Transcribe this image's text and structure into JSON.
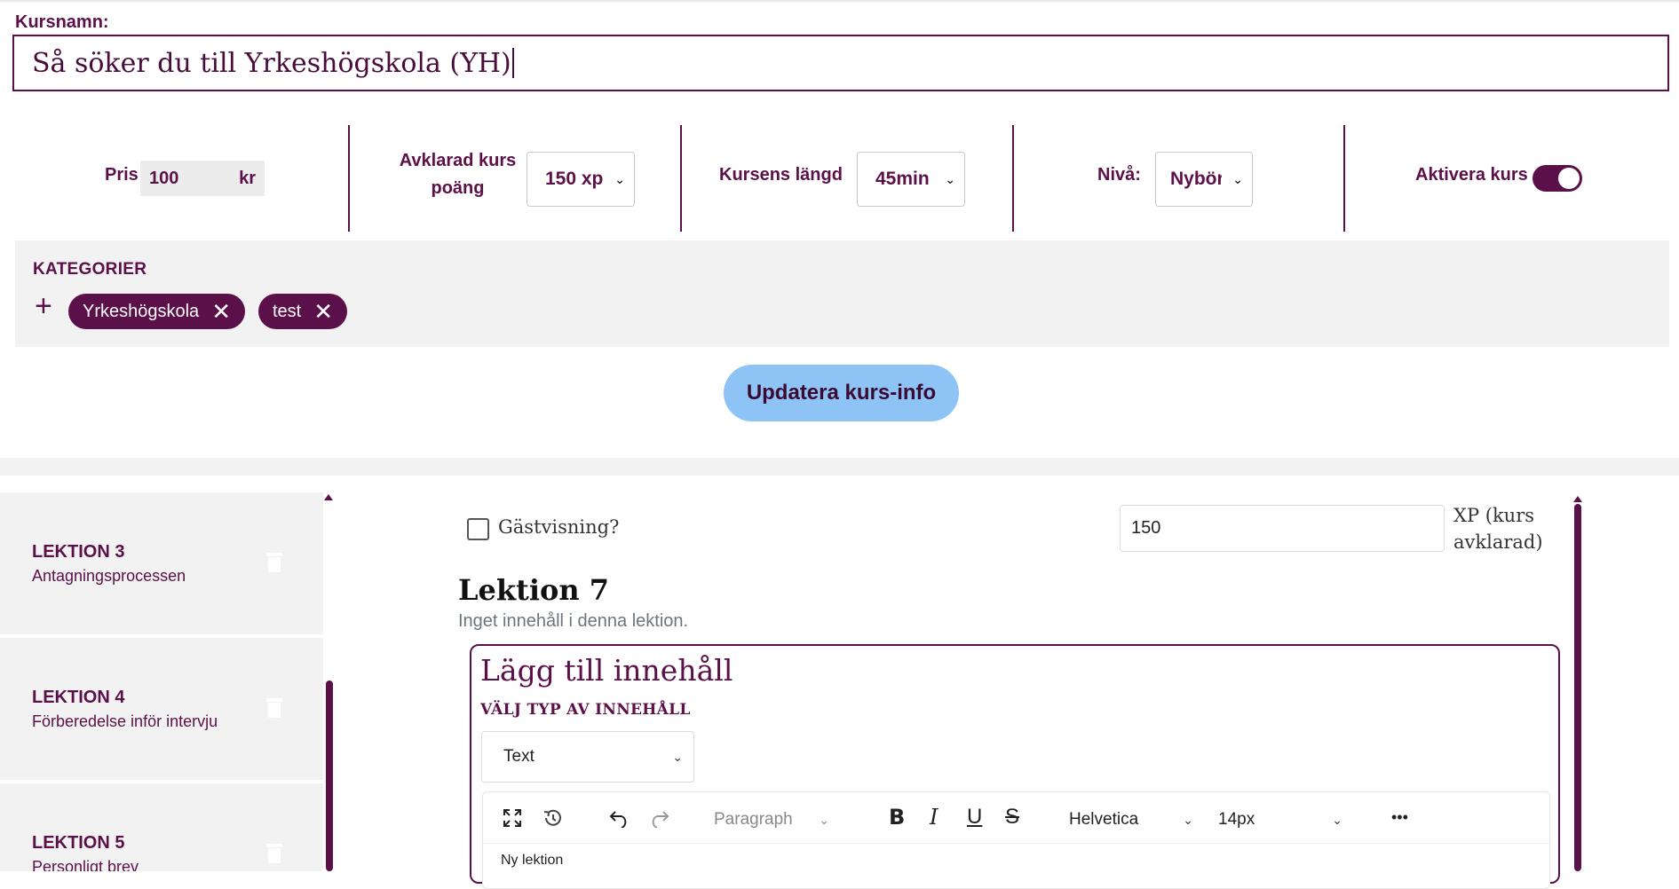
{
  "course": {
    "name_label": "Kursnamn:",
    "name_value": "Så söker du till Yrkeshögskola (YH)"
  },
  "settings": {
    "price_label": "Pris",
    "price_value": "100",
    "price_unit": "kr",
    "xp_label_line1": "Avklarad kurs",
    "xp_label_line2": "poäng",
    "xp_value": "150 xp",
    "length_label": "Kursens längd",
    "length_value": "45min",
    "level_label": "Nivå:",
    "level_value": "Nybörjare",
    "activate_label": "Aktivera kurs",
    "activate_on": true
  },
  "categories": {
    "title": "KATEGORIER",
    "add_icon": "plus-icon",
    "chips": [
      "Yrkeshögskola",
      "test"
    ]
  },
  "update_button": "Updatera kurs-info",
  "lessons": [
    {
      "title": "LEKTION 3",
      "subtitle": "Antagningsprocessen"
    },
    {
      "title": "LEKTION 4",
      "subtitle": "Förberedelse inför intervju"
    },
    {
      "title": "LEKTION 5",
      "subtitle": "Personligt brev"
    }
  ],
  "editor": {
    "guest_label": "Gästvisning?",
    "guest_checked": false,
    "xp_value": "150",
    "xp_label": "XP (kurs avklarad)",
    "lesson_title": "Lektion 7",
    "no_content": "Inget innehåll i denna lektion.",
    "add_title": "Lägg till innehåll",
    "add_subtitle": "VÄLJ TYP AV INNEHÅLL",
    "content_type": "Text",
    "toolbar": {
      "paragraph": "Paragraph",
      "font": "Helvetica",
      "size": "14px",
      "bold": "B",
      "italic": "I",
      "underline": "U",
      "strike": "S",
      "more": "•••"
    },
    "body_text": "Ny lektion"
  },
  "colors": {
    "brand": "#5c1049",
    "button": "#8ec3f5",
    "panel": "#f2f2f2"
  }
}
